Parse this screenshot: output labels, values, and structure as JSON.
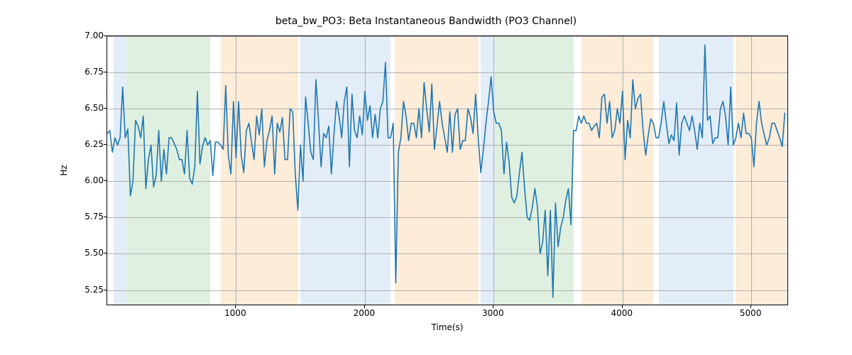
{
  "chart_data": {
    "type": "line",
    "title": "beta_bw_PO3: Beta Instantaneous Bandwidth (PO3 Channel)",
    "xlabel": "Time(s)",
    "ylabel": "Hz",
    "xlim": [
      0,
      5280
    ],
    "ylim": [
      5.15,
      7.0
    ],
    "xticks": [
      1000,
      2000,
      3000,
      4000,
      5000
    ],
    "yticks": [
      5.25,
      5.5,
      5.75,
      6.0,
      6.25,
      6.5,
      6.75,
      7.0
    ],
    "ytick_labels": [
      "5.25",
      "5.50",
      "5.75",
      "6.00",
      "6.25",
      "6.50",
      "6.75",
      "7.00"
    ],
    "bands": [
      {
        "start": 50,
        "end": 150,
        "color": "blue"
      },
      {
        "start": 150,
        "end": 800,
        "color": "green"
      },
      {
        "start": 880,
        "end": 1480,
        "color": "orange"
      },
      {
        "start": 1500,
        "end": 2100,
        "color": "blue"
      },
      {
        "start": 2100,
        "end": 2200,
        "color": "blue"
      },
      {
        "start": 2230,
        "end": 2880,
        "color": "orange"
      },
      {
        "start": 2900,
        "end": 3010,
        "color": "blue"
      },
      {
        "start": 3010,
        "end": 3620,
        "color": "green"
      },
      {
        "start": 3680,
        "end": 4240,
        "color": "orange"
      },
      {
        "start": 4280,
        "end": 4860,
        "color": "blue"
      },
      {
        "start": 4880,
        "end": 5270,
        "color": "orange"
      }
    ],
    "line_color": "#1f77b4",
    "x": [
      0,
      20,
      40,
      60,
      80,
      100,
      120,
      140,
      160,
      180,
      200,
      220,
      240,
      260,
      280,
      300,
      320,
      340,
      360,
      380,
      400,
      420,
      440,
      460,
      480,
      500,
      520,
      540,
      560,
      580,
      600,
      620,
      640,
      660,
      680,
      700,
      720,
      740,
      760,
      780,
      800,
      820,
      840,
      860,
      880,
      900,
      920,
      940,
      960,
      980,
      1000,
      1020,
      1040,
      1060,
      1080,
      1100,
      1120,
      1140,
      1160,
      1180,
      1200,
      1220,
      1240,
      1260,
      1280,
      1300,
      1320,
      1340,
      1360,
      1380,
      1400,
      1420,
      1440,
      1460,
      1480,
      1500,
      1520,
      1540,
      1560,
      1580,
      1600,
      1620,
      1640,
      1660,
      1680,
      1700,
      1720,
      1740,
      1760,
      1780,
      1800,
      1820,
      1840,
      1860,
      1880,
      1900,
      1920,
      1940,
      1960,
      1980,
      2000,
      2020,
      2040,
      2060,
      2080,
      2100,
      2120,
      2140,
      2160,
      2180,
      2200,
      2220,
      2240,
      2260,
      2280,
      2300,
      2320,
      2340,
      2360,
      2380,
      2400,
      2420,
      2440,
      2460,
      2480,
      2500,
      2520,
      2540,
      2560,
      2580,
      2600,
      2620,
      2640,
      2660,
      2680,
      2700,
      2720,
      2740,
      2760,
      2780,
      2800,
      2820,
      2840,
      2860,
      2880,
      2900,
      2920,
      2940,
      2960,
      2980,
      3000,
      3020,
      3040,
      3060,
      3080,
      3100,
      3120,
      3140,
      3160,
      3180,
      3200,
      3220,
      3240,
      3260,
      3280,
      3300,
      3320,
      3340,
      3360,
      3380,
      3400,
      3420,
      3440,
      3460,
      3480,
      3500,
      3520,
      3540,
      3560,
      3580,
      3600,
      3620,
      3640,
      3660,
      3680,
      3700,
      3720,
      3740,
      3760,
      3780,
      3800,
      3820,
      3840,
      3860,
      3880,
      3900,
      3920,
      3940,
      3960,
      3980,
      4000,
      4020,
      4040,
      4060,
      4080,
      4100,
      4120,
      4140,
      4160,
      4180,
      4200,
      4220,
      4240,
      4260,
      4280,
      4300,
      4320,
      4340,
      4360,
      4380,
      4400,
      4420,
      4440,
      4460,
      4480,
      4500,
      4520,
      4540,
      4560,
      4580,
      4600,
      4620,
      4640,
      4660,
      4680,
      4700,
      4720,
      4740,
      4760,
      4780,
      4800,
      4820,
      4840,
      4860,
      4880,
      4900,
      4920,
      4940,
      4960,
      4980,
      5000,
      5020,
      5040,
      5060,
      5080,
      5100,
      5120,
      5140,
      5160,
      5180,
      5200,
      5220,
      5240,
      5260
    ],
    "y": [
      6.33,
      6.35,
      6.2,
      6.3,
      6.25,
      6.3,
      6.65,
      6.3,
      6.36,
      5.9,
      6.0,
      6.42,
      6.38,
      6.3,
      6.45,
      5.95,
      6.15,
      6.25,
      5.96,
      6.04,
      6.35,
      6.0,
      6.22,
      6.05,
      6.3,
      6.3,
      6.26,
      6.22,
      6.15,
      6.15,
      6.05,
      6.35,
      6.02,
      5.98,
      6.1,
      6.62,
      6.12,
      6.24,
      6.3,
      6.25,
      6.28,
      6.04,
      6.27,
      6.27,
      6.25,
      6.22,
      6.66,
      6.18,
      6.05,
      6.55,
      6.16,
      6.55,
      6.18,
      6.06,
      6.35,
      6.4,
      6.27,
      6.15,
      6.45,
      6.32,
      6.5,
      6.1,
      6.28,
      6.35,
      6.45,
      6.05,
      6.4,
      6.34,
      6.44,
      6.15,
      6.15,
      6.5,
      6.48,
      6.05,
      5.8,
      6.25,
      6.0,
      6.58,
      6.4,
      6.2,
      6.15,
      6.7,
      6.42,
      6.1,
      6.33,
      6.3,
      6.38,
      6.05,
      6.32,
      6.55,
      6.45,
      6.3,
      6.55,
      6.65,
      6.1,
      6.6,
      6.35,
      6.3,
      6.45,
      6.32,
      6.62,
      6.42,
      6.52,
      6.3,
      6.46,
      6.3,
      6.5,
      6.55,
      6.82,
      6.3,
      6.3,
      6.4,
      5.3,
      6.2,
      6.3,
      6.55,
      6.45,
      6.28,
      6.4,
      6.4,
      6.3,
      6.5,
      6.3,
      6.68,
      6.5,
      6.34,
      6.67,
      6.22,
      6.38,
      6.55,
      6.4,
      6.3,
      6.2,
      6.48,
      6.2,
      6.46,
      6.5,
      6.22,
      6.28,
      6.28,
      6.5,
      6.44,
      6.33,
      6.6,
      6.3,
      6.06,
      6.22,
      6.4,
      6.55,
      6.72,
      6.48,
      6.4,
      6.4,
      6.35,
      6.05,
      6.27,
      6.13,
      5.89,
      5.85,
      5.9,
      6.06,
      6.2,
      5.95,
      5.75,
      5.73,
      5.82,
      5.95,
      5.82,
      5.5,
      5.58,
      5.8,
      5.35,
      5.8,
      5.2,
      5.85,
      5.55,
      5.68,
      5.75,
      5.87,
      5.95,
      5.7,
      6.35,
      6.35,
      6.45,
      6.4,
      6.45,
      6.4,
      6.4,
      6.35,
      6.38,
      6.4,
      6.3,
      6.58,
      6.6,
      6.4,
      6.55,
      6.3,
      6.35,
      6.5,
      6.4,
      6.62,
      6.15,
      6.42,
      6.3,
      6.7,
      6.5,
      6.57,
      6.6,
      6.35,
      6.18,
      6.32,
      6.43,
      6.4,
      6.3,
      6.3,
      6.4,
      6.55,
      6.4,
      6.26,
      6.32,
      6.28,
      6.54,
      6.18,
      6.4,
      6.45,
      6.4,
      6.35,
      6.45,
      6.35,
      6.22,
      6.4,
      6.3,
      6.94,
      6.42,
      6.45,
      6.26,
      6.3,
      6.3,
      6.5,
      6.55,
      6.45,
      6.25,
      6.65,
      6.25,
      6.3,
      6.4,
      6.3,
      6.47,
      6.33,
      6.33,
      6.3,
      6.1,
      6.4,
      6.55,
      6.4,
      6.32,
      6.25,
      6.3,
      6.4,
      6.4,
      6.35,
      6.3,
      6.24,
      6.47
    ]
  }
}
